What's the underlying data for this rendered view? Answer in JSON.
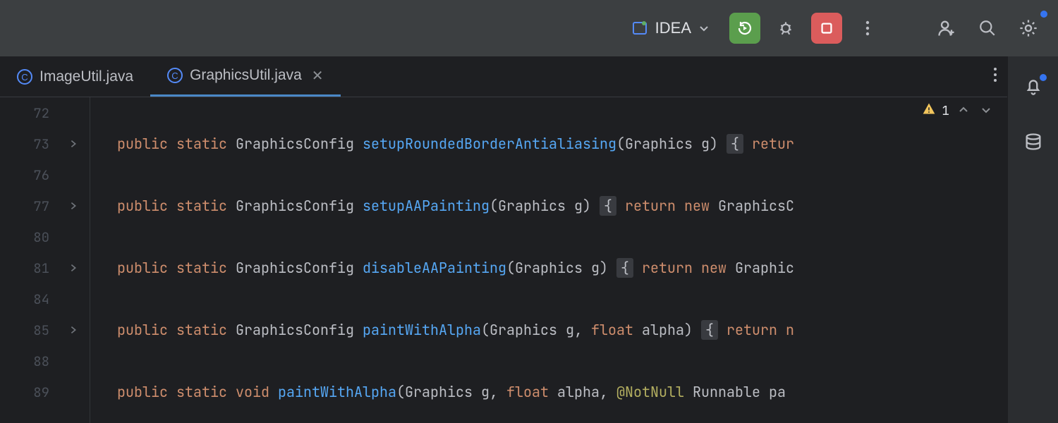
{
  "toolbar": {
    "run_config_label": "IDEA"
  },
  "tabs": [
    {
      "label": "ImageUtil.java",
      "active": false,
      "closable": false
    },
    {
      "label": "GraphicsUtil.java",
      "active": true,
      "closable": true
    }
  ],
  "inspection": {
    "warning_count": "1"
  },
  "code": {
    "lines": [
      {
        "num": "72",
        "fold": false,
        "blank": true
      },
      {
        "num": "73",
        "fold": true,
        "tokens": [
          {
            "c": "kw",
            "t": "public"
          },
          {
            "c": "",
            "t": " "
          },
          {
            "c": "kw",
            "t": "static"
          },
          {
            "c": "",
            "t": " "
          },
          {
            "c": "ty",
            "t": "GraphicsConfig"
          },
          {
            "c": "",
            "t": " "
          },
          {
            "c": "fn",
            "t": "setupRoundedBorderAntialiasing"
          },
          {
            "c": "",
            "t": "(Graphics g) "
          },
          {
            "c": "fold-brace",
            "t": "{"
          },
          {
            "c": "",
            "t": " "
          },
          {
            "c": "kw",
            "t": "retur"
          }
        ]
      },
      {
        "num": "76",
        "fold": false,
        "blank": true
      },
      {
        "num": "77",
        "fold": true,
        "tokens": [
          {
            "c": "kw",
            "t": "public"
          },
          {
            "c": "",
            "t": " "
          },
          {
            "c": "kw",
            "t": "static"
          },
          {
            "c": "",
            "t": " "
          },
          {
            "c": "ty",
            "t": "GraphicsConfig"
          },
          {
            "c": "",
            "t": " "
          },
          {
            "c": "fn",
            "t": "setupAAPainting"
          },
          {
            "c": "",
            "t": "(Graphics g) "
          },
          {
            "c": "fold-brace",
            "t": "{"
          },
          {
            "c": "",
            "t": " "
          },
          {
            "c": "kw",
            "t": "return"
          },
          {
            "c": "",
            "t": " "
          },
          {
            "c": "kw",
            "t": "new"
          },
          {
            "c": "",
            "t": " GraphicsC"
          }
        ]
      },
      {
        "num": "80",
        "fold": false,
        "blank": true
      },
      {
        "num": "81",
        "fold": true,
        "tokens": [
          {
            "c": "kw",
            "t": "public"
          },
          {
            "c": "",
            "t": " "
          },
          {
            "c": "kw",
            "t": "static"
          },
          {
            "c": "",
            "t": " "
          },
          {
            "c": "ty",
            "t": "GraphicsConfig"
          },
          {
            "c": "",
            "t": " "
          },
          {
            "c": "fn",
            "t": "disableAAPainting"
          },
          {
            "c": "",
            "t": "(Graphics g) "
          },
          {
            "c": "fold-brace",
            "t": "{"
          },
          {
            "c": "",
            "t": " "
          },
          {
            "c": "kw",
            "t": "return"
          },
          {
            "c": "",
            "t": " "
          },
          {
            "c": "kw",
            "t": "new"
          },
          {
            "c": "",
            "t": " Graphic"
          }
        ]
      },
      {
        "num": "84",
        "fold": false,
        "blank": true
      },
      {
        "num": "85",
        "fold": true,
        "tokens": [
          {
            "c": "kw",
            "t": "public"
          },
          {
            "c": "",
            "t": " "
          },
          {
            "c": "kw",
            "t": "static"
          },
          {
            "c": "",
            "t": " "
          },
          {
            "c": "ty",
            "t": "GraphicsConfig"
          },
          {
            "c": "",
            "t": " "
          },
          {
            "c": "fn",
            "t": "paintWithAlpha"
          },
          {
            "c": "",
            "t": "(Graphics g, "
          },
          {
            "c": "kw",
            "t": "float"
          },
          {
            "c": "",
            "t": " alpha) "
          },
          {
            "c": "fold-brace",
            "t": "{"
          },
          {
            "c": "",
            "t": " "
          },
          {
            "c": "kw",
            "t": "return n"
          }
        ]
      },
      {
        "num": "88",
        "fold": false,
        "blank": true
      },
      {
        "num": "89",
        "fold": false,
        "tokens": [
          {
            "c": "kw",
            "t": "public"
          },
          {
            "c": "",
            "t": " "
          },
          {
            "c": "kw",
            "t": "static"
          },
          {
            "c": "",
            "t": " "
          },
          {
            "c": "kw",
            "t": "void"
          },
          {
            "c": "",
            "t": " "
          },
          {
            "c": "fn",
            "t": "paintWithAlpha"
          },
          {
            "c": "",
            "t": "(Graphics g, "
          },
          {
            "c": "kw",
            "t": "float"
          },
          {
            "c": "",
            "t": " alpha, "
          },
          {
            "c": "an",
            "t": "@NotNull"
          },
          {
            "c": "",
            "t": " Runnable pa"
          }
        ]
      }
    ]
  }
}
